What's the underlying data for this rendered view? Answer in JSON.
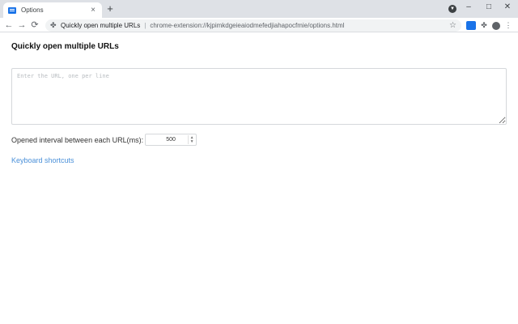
{
  "browser": {
    "tab": {
      "title": "Options",
      "close_glyph": "×"
    },
    "new_tab_glyph": "+",
    "window_controls": {
      "minimize": "–",
      "maximize": "□",
      "close": "✕"
    },
    "nav": {
      "back": "←",
      "forward": "→",
      "reload": "⟳"
    },
    "omnibox": {
      "site_name": "Quickly open multiple URLs",
      "separator": "|",
      "url": "chrome-extension://kjpimkdgeieaiodmefedjiahapocfmie/options.html"
    }
  },
  "page": {
    "title": "Quickly open multiple URLs",
    "textarea": {
      "placeholder": "Enter the URL, one per line",
      "value": ""
    },
    "interval": {
      "label": "Opened interval between each URL(ms):",
      "value": "500"
    },
    "shortcuts_link": "Keyboard shortcuts"
  },
  "colors": {
    "accent": "#1a73e8",
    "link": "#4a90d9"
  }
}
